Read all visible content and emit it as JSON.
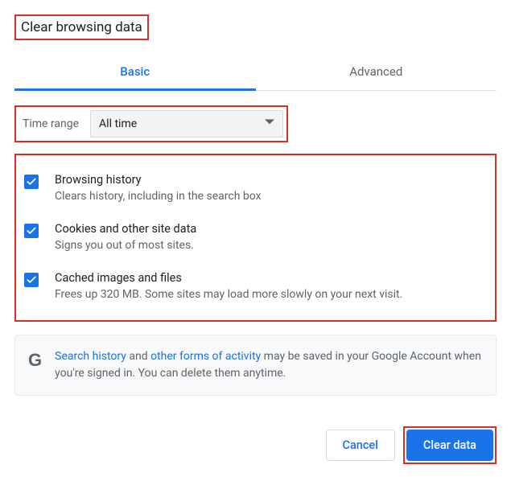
{
  "title": "Clear browsing data",
  "tabs": {
    "basic": "Basic",
    "advanced": "Advanced"
  },
  "timerange": {
    "label": "Time range",
    "value": "All time"
  },
  "options": [
    {
      "title": "Browsing history",
      "desc": "Clears history, including in the search box"
    },
    {
      "title": "Cookies and other site data",
      "desc": "Signs you out of most sites."
    },
    {
      "title": "Cached images and files",
      "desc": "Frees up 320 MB. Some sites may load more slowly on your next visit."
    }
  ],
  "info": {
    "link1": "Search history",
    "mid1": " and ",
    "link2": "other forms of activity",
    "rest": " may be saved in your Google Account when you're signed in. You can delete them anytime."
  },
  "buttons": {
    "cancel": "Cancel",
    "clear": "Clear data"
  }
}
